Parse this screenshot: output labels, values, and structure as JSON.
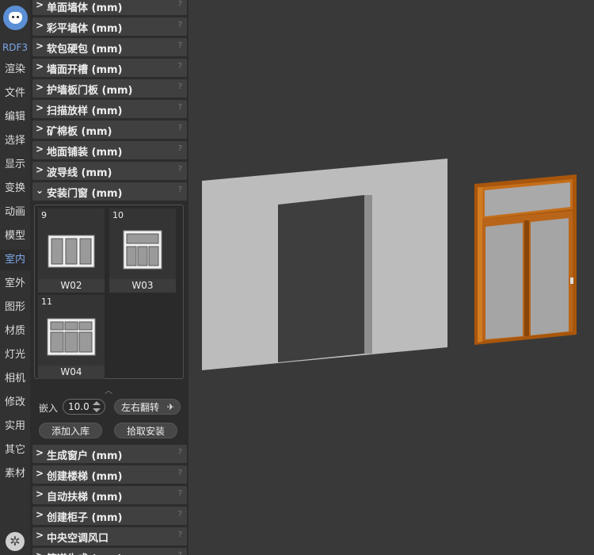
{
  "nav": {
    "rdf": "RDF3",
    "items": [
      "渲染",
      "文件",
      "编辑",
      "选择",
      "显示",
      "变换",
      "动画",
      "模型",
      "室内",
      "室外",
      "图形",
      "材质",
      "灯光",
      "相机",
      "修改",
      "实用",
      "其它",
      "素材"
    ],
    "active": "室内"
  },
  "panel": {
    "sections_top": [
      {
        "chev": ">",
        "title": "单面墙体 (mm)"
      },
      {
        "chev": ">",
        "title": "彩平墙体 (mm)"
      },
      {
        "chev": ">",
        "title": "软包硬包 (mm)"
      },
      {
        "chev": ">",
        "title": "墙面开槽 (mm)"
      },
      {
        "chev": ">",
        "title": "护墙板门板 (mm)"
      },
      {
        "chev": ">",
        "title": "扫描放样 (mm)"
      },
      {
        "chev": ">",
        "title": "矿棉板 (mm)"
      },
      {
        "chev": ">",
        "title": "地面铺装 (mm)"
      },
      {
        "chev": ">",
        "title": "波导线 (mm)"
      }
    ],
    "open_section": {
      "chev": "⌄",
      "title": "安装门窗 (mm)"
    },
    "windows": [
      {
        "num": "9",
        "label": "W02"
      },
      {
        "num": "10",
        "label": "W03"
      },
      {
        "num": "11",
        "label": "W04"
      }
    ],
    "embed_label": "嵌入",
    "embed_value": "10.0",
    "flip_label": "左右翻转",
    "add_label": "添加入库",
    "pick_label": "拾取安装",
    "sections_bottom": [
      {
        "chev": ">",
        "title": "生成窗户 (mm)"
      },
      {
        "chev": ">",
        "title": "创建楼梯 (mm)"
      },
      {
        "chev": ">",
        "title": "自动扶梯 (mm)"
      },
      {
        "chev": ">",
        "title": "创建柜子 (mm)"
      },
      {
        "chev": ">",
        "title": "中央空调风口"
      },
      {
        "chev": ">",
        "title": "管道生成 (mm)"
      }
    ],
    "help": "?"
  },
  "colors": {
    "accent": "#7da7e8",
    "wall": "#bdbdbd",
    "frame": "#b5620f"
  }
}
